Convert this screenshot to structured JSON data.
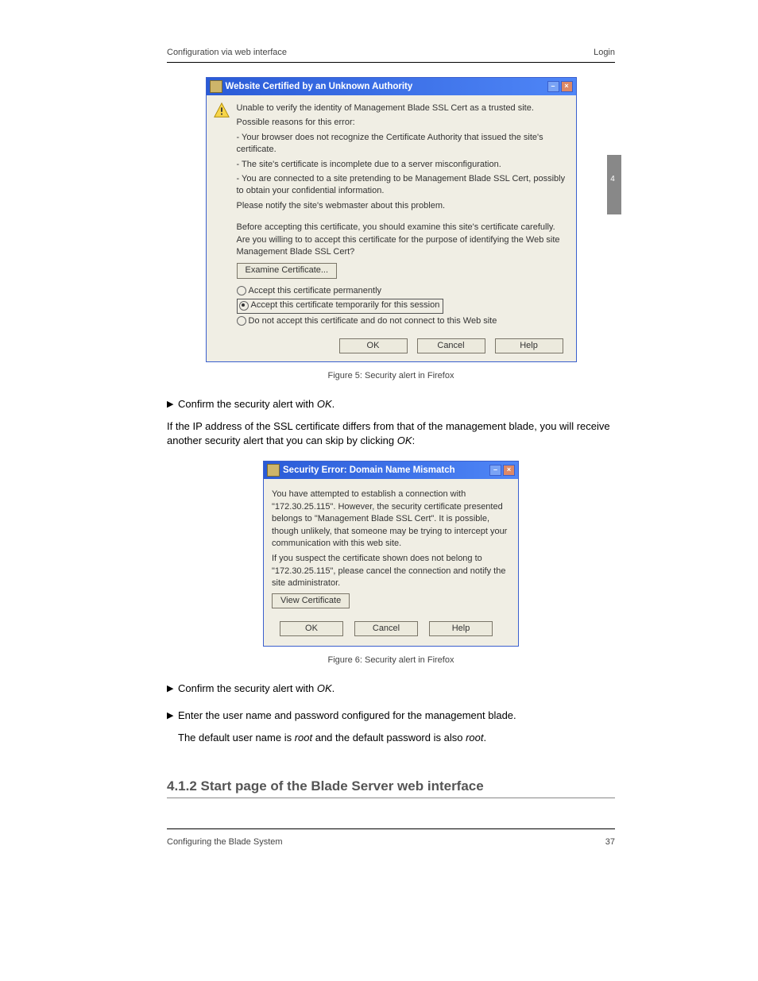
{
  "header": {
    "doc_title": "Configuration via web interface",
    "section_heading": "Login",
    "page_number": "37",
    "footer_left": "Configuring the Blade System",
    "tab_num": "4"
  },
  "dialog1": {
    "title": "Website Certified by an Unknown Authority",
    "line1": "Unable to verify the identity of Management Blade SSL Cert as a trusted site.",
    "line2": "Possible reasons for this error:",
    "bullet1": "- Your browser does not recognize the Certificate Authority that issued the site's certificate.",
    "bullet2": "- The site's certificate is incomplete due to a server misconfiguration.",
    "bullet3": "- You are connected to a site pretending to be Management Blade SSL Cert, possibly to obtain your confidential information.",
    "line3": "Please notify the site's webmaster about this problem.",
    "line4": "Before accepting this certificate, you should examine this site's certificate carefully. Are you willing to to accept this certificate for the purpose of identifying the Web site Management Blade SSL Cert?",
    "examine_btn": "Examine Certificate...",
    "radio1": "Accept this certificate permanently",
    "radio2": "Accept this certificate temporarily for this session",
    "radio3": "Do not accept this certificate and do not connect to this Web site",
    "ok": "OK",
    "cancel": "Cancel",
    "help": "Help"
  },
  "fig1_caption": "Figure 5: Security alert in Firefox",
  "step2_a": "Confirm the security alert with ",
  "step2_ok": "OK",
  "step2_b": ".",
  "para1": "If the IP address of the SSL certificate differs from that of the management blade, you will receive another security alert that you can skip by clicking ",
  "para1_ok": "OK",
  "para1_end": ":",
  "dialog2": {
    "title": "Security Error: Domain Name Mismatch",
    "p1": "You have attempted to establish a connection with \"172.30.25.115\". However, the security certificate presented belongs to \"Management Blade SSL Cert\". It is possible, though unlikely, that someone may be trying to intercept your communication with this web site.",
    "p2": "If you suspect the certificate shown does not belong to \"172.30.25.115\", please cancel the connection and notify the site administrator.",
    "view_btn": "View Certificate",
    "ok": "OK",
    "cancel": "Cancel",
    "help": "Help"
  },
  "fig2_caption": "Figure 6: Security alert in Firefox",
  "step3_a": "Confirm the security alert with ",
  "step3_ok": "OK",
  "step3_b": ".",
  "step4_a": "Enter the user name and password configured for the management blade.",
  "step4_note_a": "The default user name is ",
  "step4_note_root": "root",
  "step4_note_b": " and the default password is also ",
  "step4_note_root2": "root",
  "step4_note_c": ".",
  "start_heading": "4.1.2   Start page of the Blade Server web interface"
}
